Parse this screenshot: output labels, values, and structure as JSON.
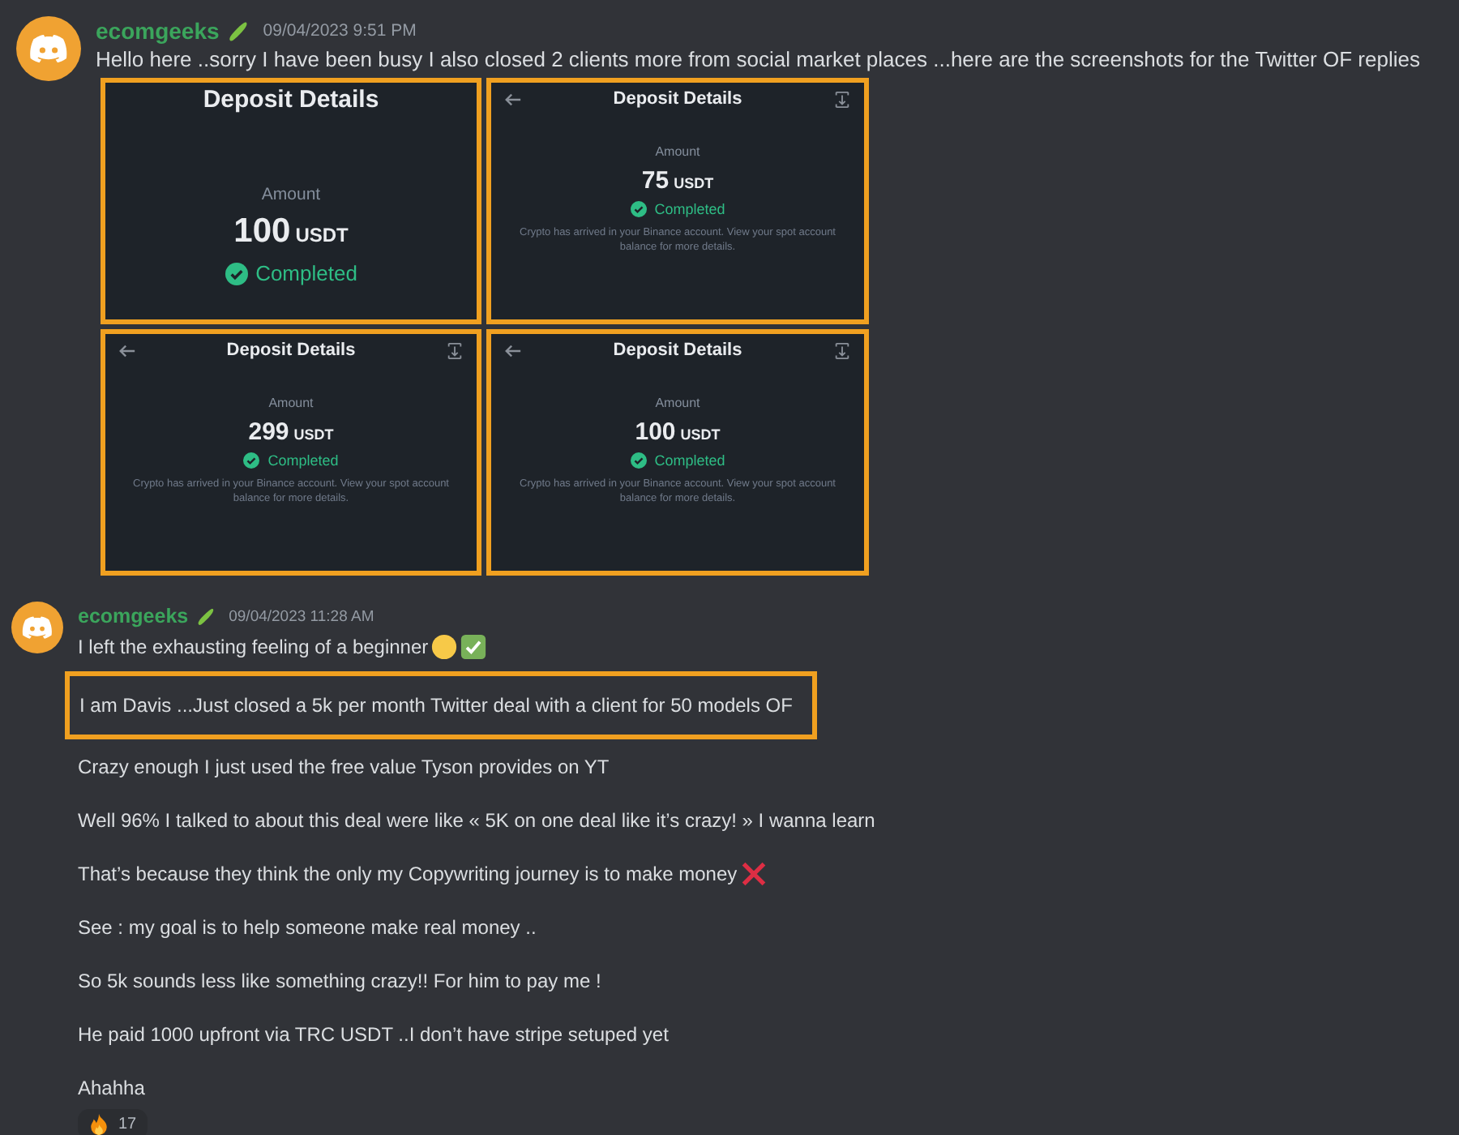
{
  "messages": [
    {
      "author": "ecomgeeks",
      "timestamp": "09/04/2023 9:51 PM",
      "text": "Hello here ..sorry I have been busy I also closed 2 clients more from social market places ...here are the screenshots for the Twitter OF replies",
      "attachments": [
        {
          "kind": "plain",
          "title": "Deposit Details",
          "amount_label": "Amount",
          "amount": "100",
          "unit": "USDT",
          "status": "Completed"
        },
        {
          "kind": "nav",
          "title": "Deposit Details",
          "amount_label": "Amount",
          "amount": "75",
          "unit": "USDT",
          "status": "Completed",
          "note": "Crypto has arrived in your Binance account. View your spot account balance for more details."
        },
        {
          "kind": "nav",
          "title": "Deposit Details",
          "amount_label": "Amount",
          "amount": "299",
          "unit": "USDT",
          "status": "Completed",
          "note": "Crypto has arrived in your Binance account. View your spot account balance for more details."
        },
        {
          "kind": "nav",
          "title": "Deposit Details",
          "amount_label": "Amount",
          "amount": "100",
          "unit": "USDT",
          "status": "Completed",
          "note": "Crypto has arrived in your Binance account. View your spot account balance for more details."
        }
      ]
    },
    {
      "author": "ecomgeeks",
      "timestamp": "09/04/2023 11:28 AM",
      "lines": [
        {
          "kind": "emojis",
          "text": "I left the exhausting feeling of a beginner",
          "highlighted": false
        },
        {
          "kind": "plain",
          "text": "I am Davis ...Just closed a 5k per month Twitter deal with a client for 50 models OF",
          "highlighted": true
        },
        {
          "kind": "plain",
          "text": "Crazy enough I just used the free value Tyson provides on YT",
          "highlighted": false
        },
        {
          "kind": "plain",
          "text": "Well 96% I talked to about this deal were like  « 5K on one deal like it’s crazy! » I wanna learn",
          "highlighted": false
        },
        {
          "kind": "cross",
          "text": "That’s because they think the only my Copywriting journey is to make money",
          "highlighted": false
        },
        {
          "kind": "plain",
          "text": "See : my goal is to help someone make real money ..",
          "highlighted": false
        },
        {
          "kind": "plain",
          "text": "So 5k sounds less like something crazy!! For him to pay me !",
          "highlighted": false
        },
        {
          "kind": "plain",
          "text": "He paid 1000 upfront via TRC USDT ..I don’t have stripe setuped yet",
          "highlighted": false
        },
        {
          "kind": "plain",
          "text": "Ahahha",
          "highlighted": false
        }
      ],
      "reaction": {
        "count": "17"
      }
    }
  ]
}
